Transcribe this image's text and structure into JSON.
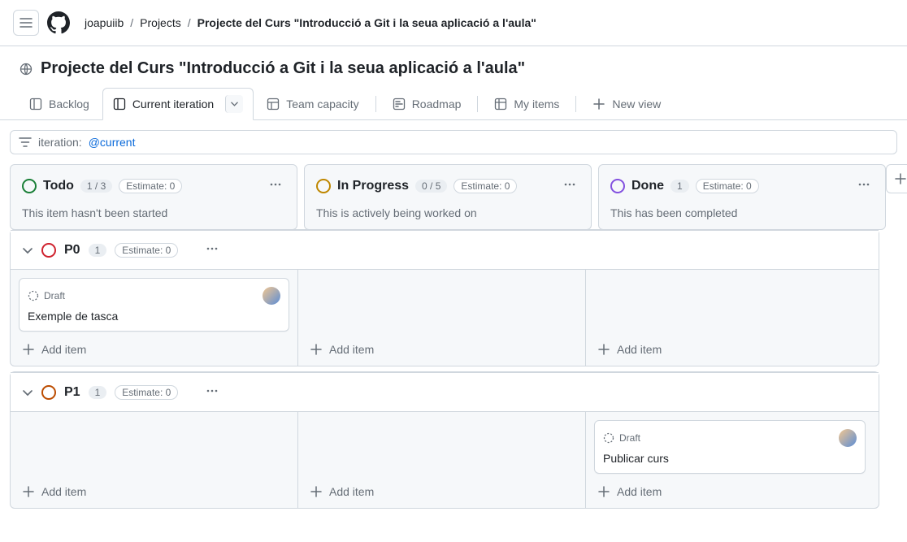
{
  "breadcrumb": {
    "user": "joapuiib",
    "section": "Projects",
    "project": "Projecte del Curs \"Introducció a Git i la seua aplicació a l'aula\""
  },
  "title": "Projecte del Curs \"Introducció a Git i la seua aplicació a l'aula\"",
  "tabs": {
    "backlog": "Backlog",
    "current": "Current iteration",
    "team": "Team capacity",
    "roadmap": "Roadmap",
    "myitems": "My items",
    "newview": "New view"
  },
  "filter": {
    "label": "iteration:",
    "value": "@current"
  },
  "columns": {
    "todo": {
      "name": "Todo",
      "count": "1 / 3",
      "estimate": "Estimate: 0",
      "desc": "This item hasn't been started"
    },
    "inprogress": {
      "name": "In Progress",
      "count": "0 / 5",
      "estimate": "Estimate: 0",
      "desc": "This is actively being worked on"
    },
    "done": {
      "name": "Done",
      "count": "1",
      "estimate": "Estimate: 0",
      "desc": "This has been completed"
    }
  },
  "groups": {
    "p0": {
      "name": "P0",
      "count": "1",
      "estimate": "Estimate: 0"
    },
    "p1": {
      "name": "P1",
      "count": "1",
      "estimate": "Estimate: 0"
    }
  },
  "cards": {
    "draft_label": "Draft",
    "c1_title": "Exemple de tasca",
    "c2_title": "Publicar curs"
  },
  "add_item": "Add item"
}
